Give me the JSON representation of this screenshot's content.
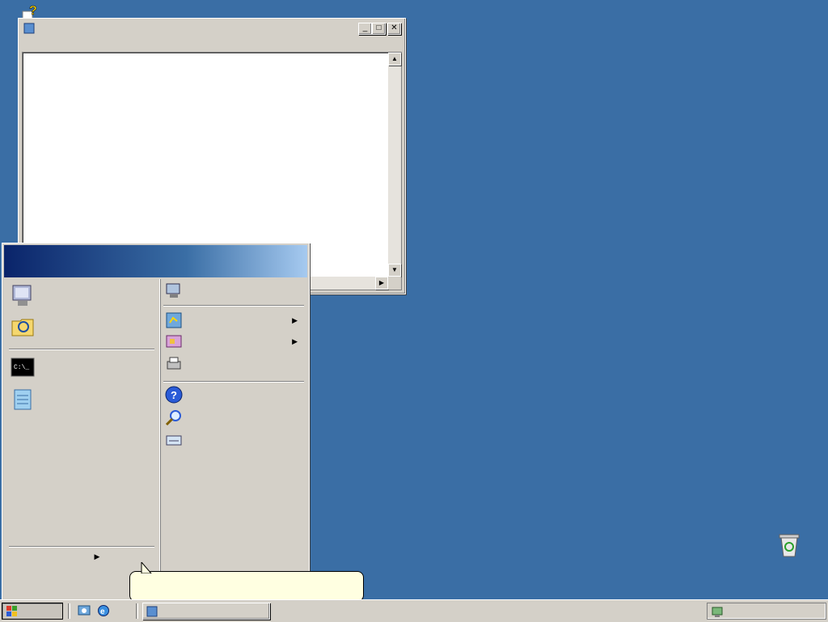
{
  "window": {
    "title": "",
    "menu": [
      "",
      "",
      "",
      "",
      ""
    ],
    "content_text": ""
  },
  "start_menu": {
    "header": "",
    "left_items": [
      {
        "label": "",
        "icon": "my-computer-icon"
      },
      {
        "label": "",
        "icon": "windows-explorer-icon"
      },
      {
        "label": "",
        "icon": "command-prompt-icon"
      },
      {
        "label": "",
        "icon": "notepad-icon"
      }
    ],
    "all_programs": "",
    "right_items": [
      {
        "label": "",
        "icon": "computer-network-icon",
        "submenu": false
      },
      {
        "label": "",
        "icon": "control-panel-icon",
        "submenu": true
      },
      {
        "label": "",
        "icon": "administrative-tools-icon",
        "submenu": true
      },
      {
        "label": "",
        "icon": "printers-icon",
        "submenu": false
      },
      {
        "label": "",
        "icon": "help-icon",
        "submenu": false
      },
      {
        "label": "",
        "icon": "search-icon",
        "submenu": false
      },
      {
        "label": "",
        "icon": "run-icon",
        "submenu": false
      }
    ]
  },
  "tooltip": {
    "text": ""
  },
  "taskbar": {
    "start_label": "",
    "task_label": "",
    "tray_items": [
      "",
      ""
    ]
  },
  "desktop": {
    "recycle_bin_label": ""
  },
  "colors": {
    "desktop": "#3a6ea5",
    "window_face": "#d4d0c8",
    "tooltip": "#ffffe1"
  }
}
